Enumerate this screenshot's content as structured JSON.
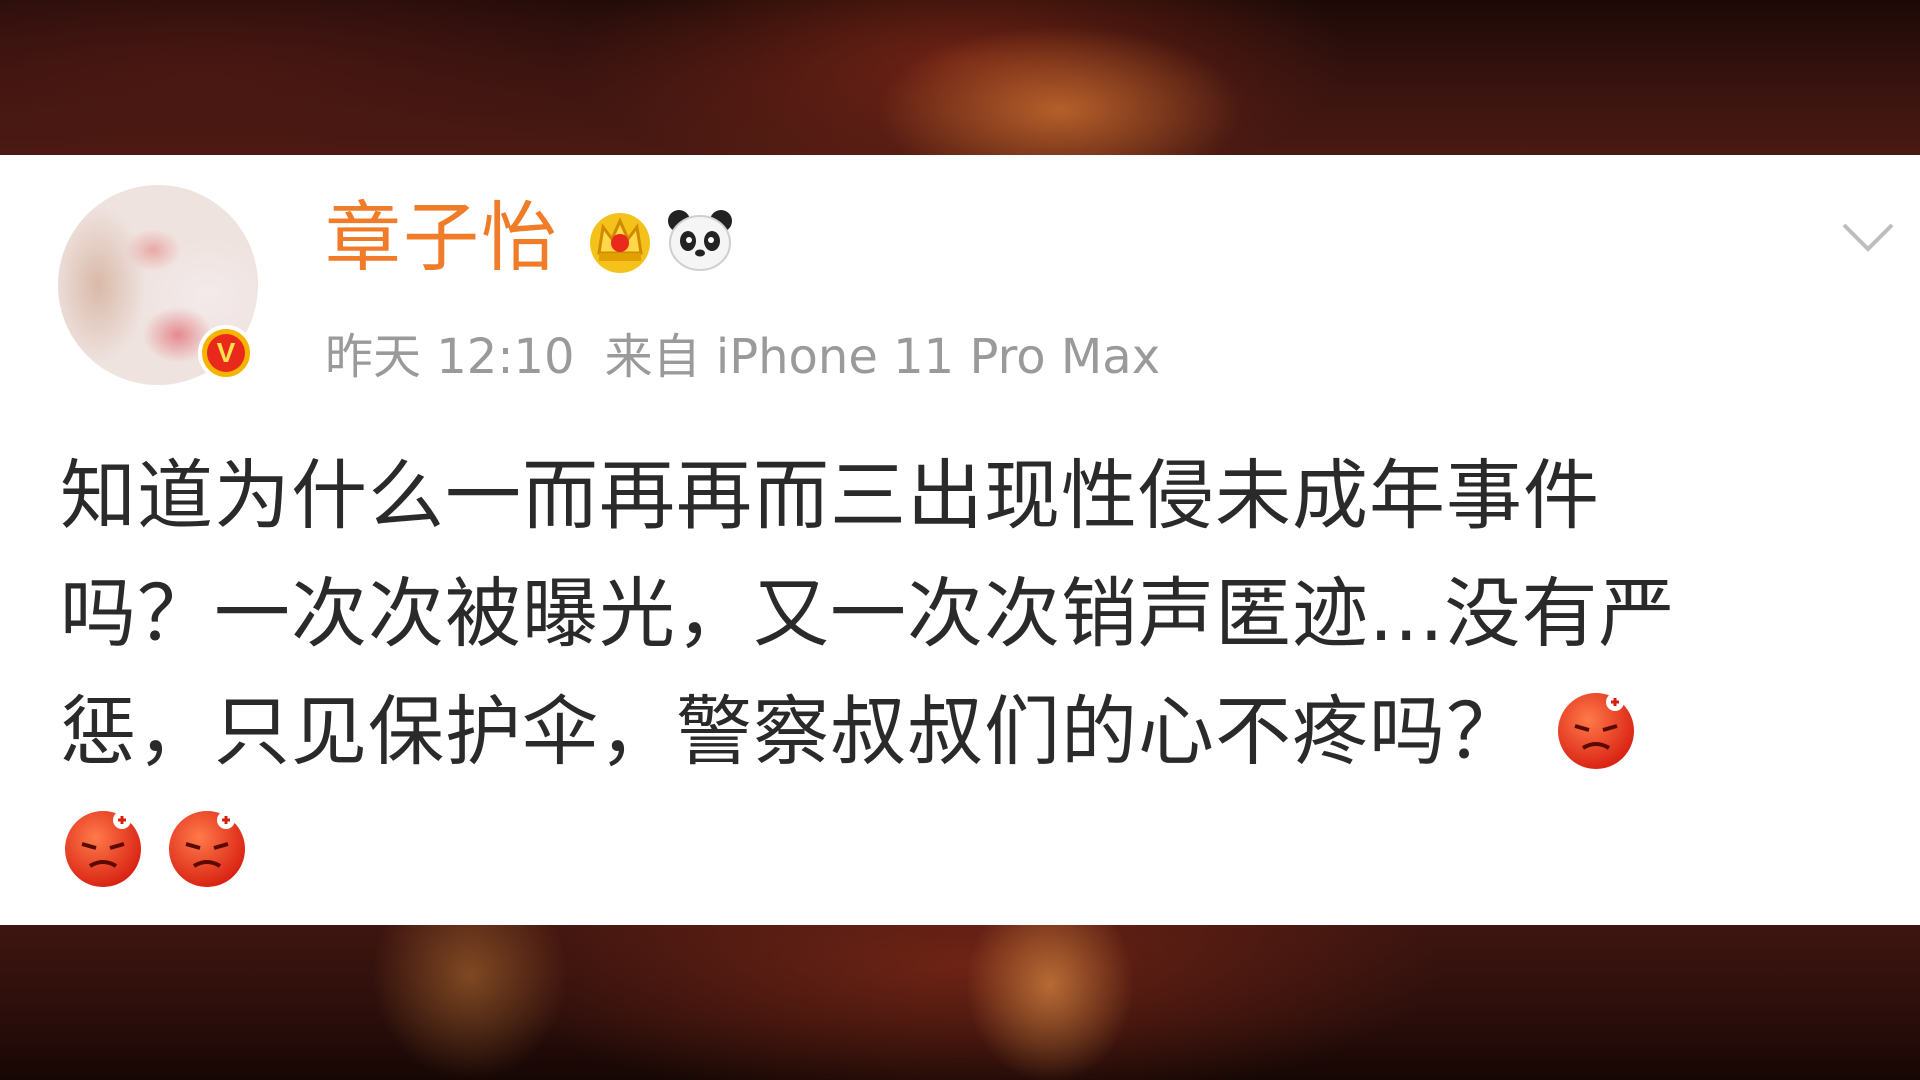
{
  "post": {
    "username": "章子怡",
    "verified_mark": "V",
    "time": "昨天 12:10",
    "source": "来自 iPhone 11 Pro Max",
    "badges": [
      "crown-icon",
      "panda-icon"
    ],
    "text_lines": [
      "知道为什么一而再再而三出现性侵未成年事件",
      "吗？一次次被曝光，又一次次销声匿迹...没有严",
      "惩，只见保护伞，警察叔叔们的心不疼吗？"
    ],
    "emoji": "angry-face-icon",
    "emoji_count": 3
  },
  "colors": {
    "username": "#f07c2a",
    "meta": "#9a9a9a",
    "text": "#2a2a2a",
    "verified_ring": "#f6b400",
    "verified_core": "#e8291c"
  }
}
